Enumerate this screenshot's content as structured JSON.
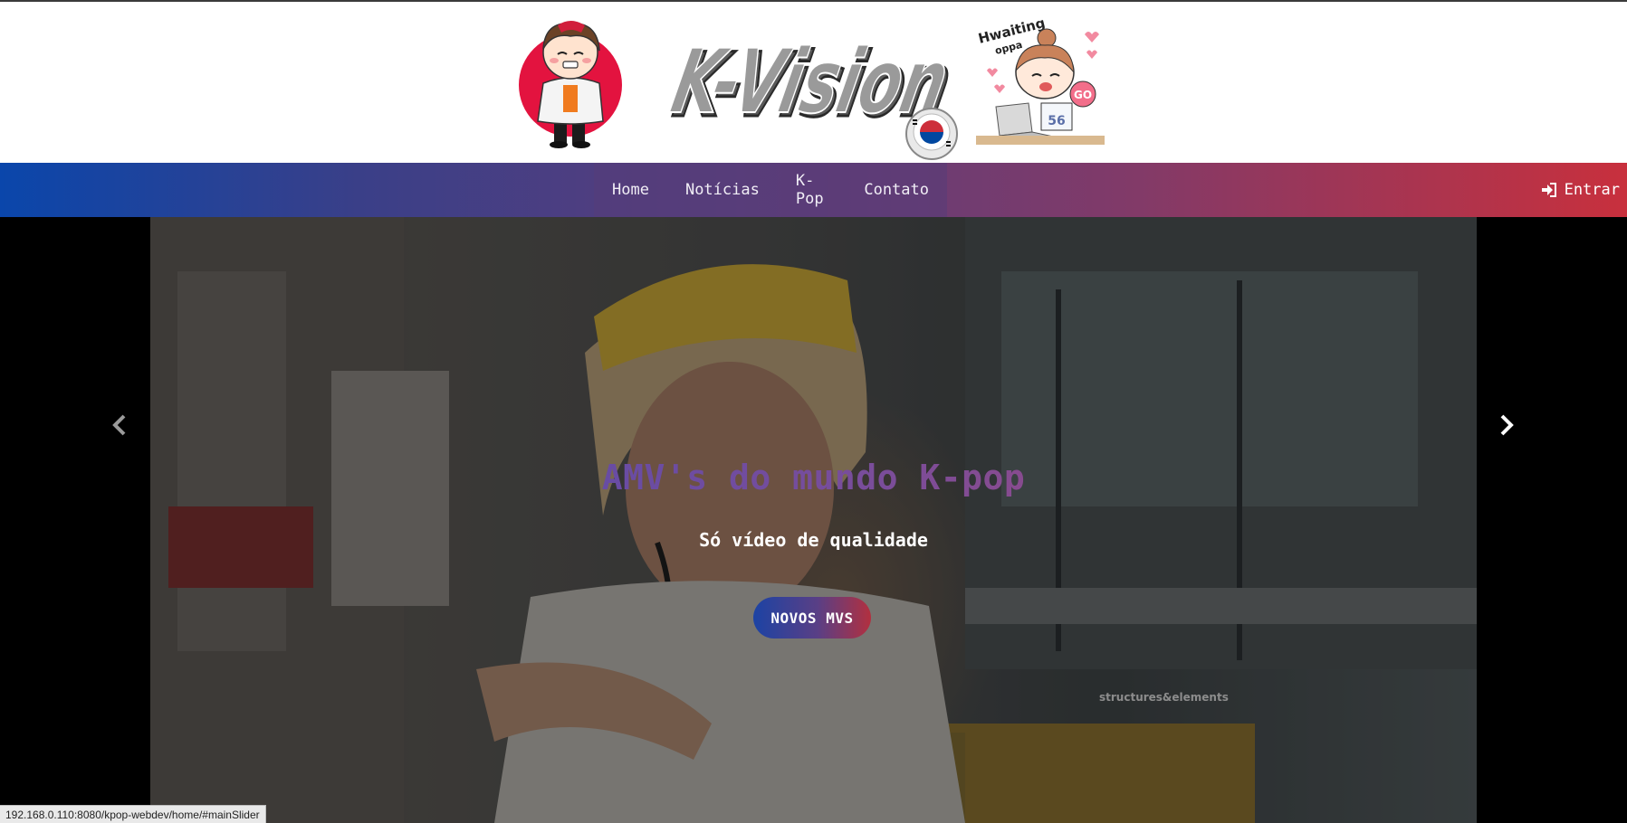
{
  "header": {
    "logo_text": "K-Vision",
    "sticker_text_top": "Hwaiting",
    "sticker_text_sub": "oppa",
    "sticker_go": "GO",
    "jersey_number": "56"
  },
  "nav": {
    "items": [
      {
        "label": "Home"
      },
      {
        "label": "Notícias"
      },
      {
        "label": "K-Pop"
      },
      {
        "label": "Contato"
      }
    ],
    "login_label": "Entrar",
    "login_icon": "sign-in-icon"
  },
  "slider": {
    "title": "AMV's do mundo K-pop",
    "subtitle": "Só vídeo de qualidade",
    "button_label": "NOVOS MVS",
    "prev_icon": "chevron-left-icon",
    "next_icon": "chevron-right-icon",
    "scene_sign": "structures&elements"
  },
  "status_bar": {
    "url": "192.168.0.110:8080/kpop-webdev/home/#mainSlider"
  },
  "colors": {
    "nav_gradient_start": "#0a46ab",
    "nav_gradient_end": "#c8303d",
    "nav_menu_bg": "#553c78",
    "button_gradient_start": "#1c43a4",
    "button_gradient_end": "#b2303f"
  }
}
